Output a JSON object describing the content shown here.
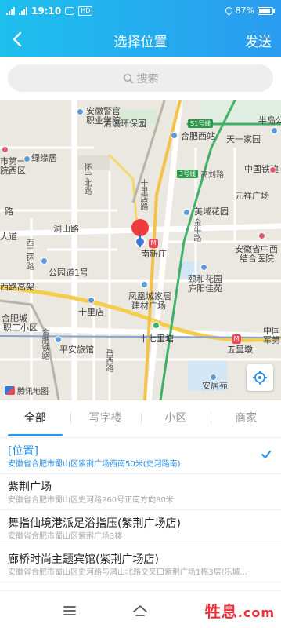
{
  "status_bar": {
    "signal_text": "5G",
    "time": "19:10",
    "hd": "HD",
    "battery": "87%"
  },
  "header": {
    "title": "选择位置",
    "send_label": "发送"
  },
  "search": {
    "placeholder": "搜索"
  },
  "map": {
    "labels": {
      "anhui_police": "安徽警官",
      "vocational": "职业学院",
      "qingxi_park": "清溪环保园",
      "s1_line": "S1号线",
      "banshan": "半岛公",
      "hefei_west": "合肥西站",
      "tianyi": "天一家园",
      "first_hospital": "市第一",
      "yuan_xiqu": "院西区",
      "luyuan": "绿缘居",
      "huaining_north": "怀宁北路",
      "line3": "3号线",
      "gaoliu": "高刘路",
      "china_railway": "中国铁建",
      "yuanxiang": "元祥广场",
      "meiyu": "美域花园",
      "road_r": "路",
      "dongshan": "洞山路",
      "shiyi_road": "十里店路",
      "jinniu": "金牛路",
      "anhui_tcm": "安徽省中西",
      "jiehe_hosp": "结合医院",
      "dadao": "大道",
      "xi2_ring": "西二环路",
      "gongyuan1": "公园道1号",
      "nanxinzhuang": "南新庄",
      "yihe": "颐和花园",
      "lujiang": "庐阳佳苑",
      "fenghuang": "凤凰城家居",
      "jiancai": "建材广场",
      "elevated": "西路高架",
      "hefei_cheng": "合肥城",
      "zhigong": "职工小区",
      "shili_dian": "十里店",
      "hefei_rail": "合肥铁路",
      "pingan": "平安旅馆",
      "shilitang": "十七里塘",
      "wulidun": "五里墩",
      "china_military": "中国",
      "military2": "军第",
      "yueshan": "岳西路",
      "anyuan": "安居苑",
      "yangguang": "阳光"
    },
    "watermark": "腾讯地图"
  },
  "tabs": [
    {
      "label": "全部",
      "active": true
    },
    {
      "label": "写字楼",
      "active": false
    },
    {
      "label": "小区",
      "active": false
    },
    {
      "label": "商家",
      "active": false
    }
  ],
  "places": [
    {
      "name": "[位置]",
      "address": "安徽省合肥市蜀山区紫荆广场西南50米(史河路南)",
      "selected": true
    },
    {
      "name": "紫荆广场",
      "address": "安徽省合肥市蜀山区史河路260号正南方向80米",
      "selected": false
    },
    {
      "name": "舞指仙境港派足浴指压(紫荆广场店)",
      "address": "安徽省合肥市蜀山区紫荆广场3楼",
      "selected": false
    },
    {
      "name": "廊桥时尚主题宾馆(紫荆广场店)",
      "address": "安徽省合肥市蜀山区史河路与潜山北路交叉口紫荆广场1栋3层(乐城...",
      "selected": false
    }
  ],
  "brand": {
    "text": "牲息",
    "suffix": ".com"
  },
  "colors": {
    "header_start": "#1ec0ee",
    "header_end": "#2a9bf0",
    "accent": "#2c97f0",
    "pin": "#ee3b3b",
    "brand": "#e8323c"
  }
}
